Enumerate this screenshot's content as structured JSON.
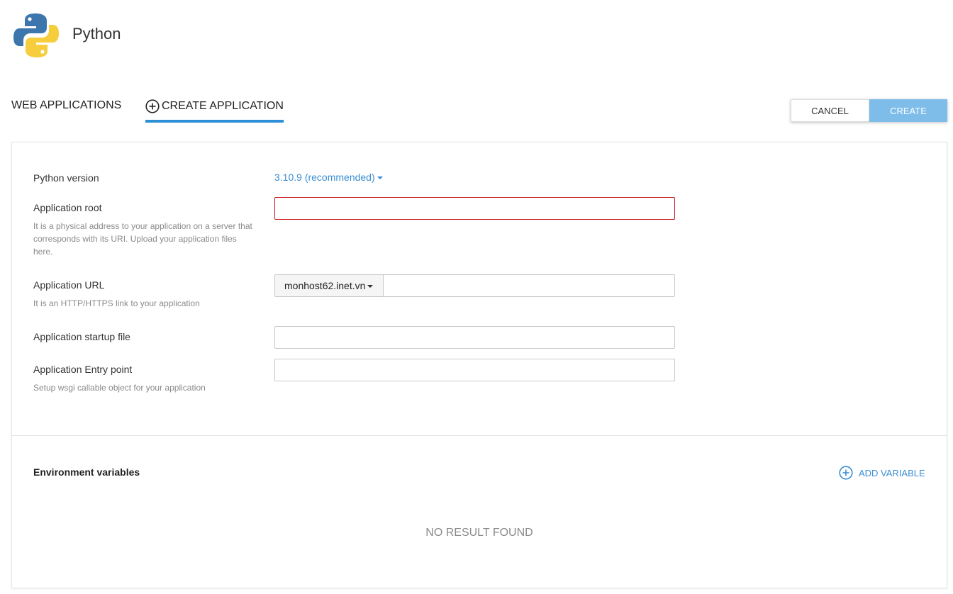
{
  "header": {
    "logo_icon": "python-logo-icon",
    "title": "Python"
  },
  "tabs": {
    "web_applications": "WEB APPLICATIONS",
    "create_application": "CREATE APPLICATION",
    "create_icon": "plus-circle-icon"
  },
  "actions": {
    "cancel_label": "CANCEL",
    "create_label": "CREATE"
  },
  "form": {
    "python_version": {
      "label": "Python version",
      "value": "3.10.9 (recommended)"
    },
    "application_root": {
      "label": "Application root",
      "hint": "It is a physical address to your application on a server that corresponds with its URI. Upload your application files here.",
      "value": ""
    },
    "application_url": {
      "label": "Application URL",
      "hint": "It is an HTTP/HTTPS link to your application",
      "domain": "monhost62.inet.vn",
      "value": ""
    },
    "startup_file": {
      "label": "Application startup file",
      "value": ""
    },
    "entry_point": {
      "label": "Application Entry point",
      "hint": "Setup wsgi callable object for your application",
      "value": ""
    }
  },
  "environment": {
    "title": "Environment variables",
    "add_label": "ADD VARIABLE",
    "add_icon": "plus-circle-icon",
    "empty_text": "NO RESULT FOUND"
  },
  "colors": {
    "accent": "#2d8fd5",
    "link": "#3a8ed3",
    "create_button": "#7ebdea",
    "error_border": "#c9141c"
  }
}
